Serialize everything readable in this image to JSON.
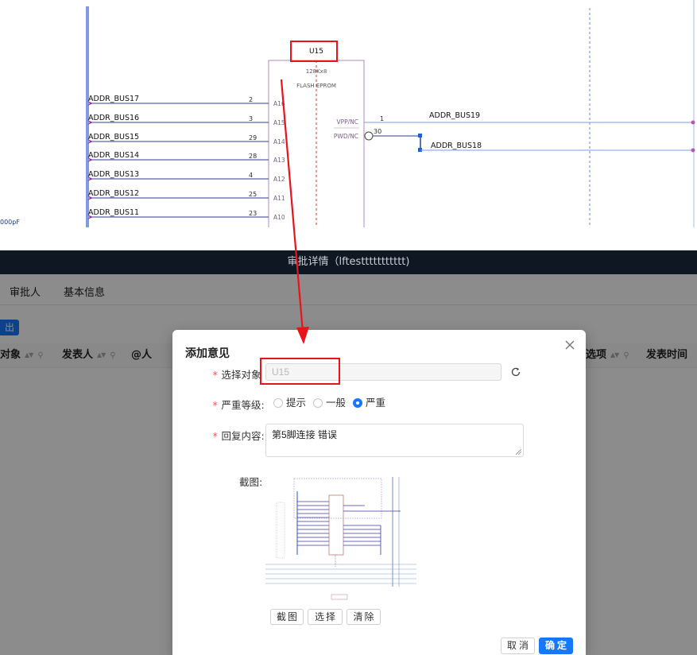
{
  "schematic": {
    "component": {
      "designator": "U15",
      "part": "128Kx8",
      "type": "FLASH EPROM"
    },
    "left_nets": [
      {
        "net": "ADDR_BUS17",
        "pin_num": "2",
        "pin_name": "A16"
      },
      {
        "net": "ADDR_BUS16",
        "pin_num": "3",
        "pin_name": "A15"
      },
      {
        "net": "ADDR_BUS15",
        "pin_num": "29",
        "pin_name": "A14"
      },
      {
        "net": "ADDR_BUS14",
        "pin_num": "28",
        "pin_name": "A13"
      },
      {
        "net": "ADDR_BUS13",
        "pin_num": "4",
        "pin_name": "A12"
      },
      {
        "net": "ADDR_BUS12",
        "pin_num": "25",
        "pin_name": "A11"
      },
      {
        "net": "ADDR_BUS11",
        "pin_num": "23",
        "pin_name": "A10"
      }
    ],
    "right_pins": [
      {
        "pin_name": "VPP/NC",
        "pin_num": "1",
        "net": "ADDR_BUS19"
      },
      {
        "pin_name": "PWD/NC",
        "pin_num": "30",
        "net": "ADDR_BUS18"
      }
    ],
    "edge_label": "000pF"
  },
  "app": {
    "title": "审批详情（lftesttttttttttt)",
    "tabs": [
      "审批人",
      "基本信息"
    ],
    "export_label": "出",
    "columns": [
      {
        "label": "对象"
      },
      {
        "label": "发表人"
      },
      {
        "label": "@人"
      },
      {
        "label": "选项"
      },
      {
        "label": "发表时间"
      }
    ]
  },
  "modal": {
    "title": "添加意见",
    "close_icon": "close-icon",
    "target": {
      "label": "选择对象",
      "value": "U15"
    },
    "severity": {
      "label": "严重等级:",
      "options": [
        "提示",
        "一般",
        "严重"
      ],
      "selected": "严重"
    },
    "reply": {
      "label": "回复内容:",
      "value": "第5脚连接 错误"
    },
    "screenshot_label": "截图:",
    "buttons": {
      "capture": "截图",
      "choose": "选择",
      "clear": "清除",
      "cancel": "取消",
      "ok": "确定"
    }
  },
  "colors": {
    "accent": "#1677ff",
    "highlight": "#e8141a",
    "wire": "#2e3f8c",
    "component": "#a05aa8"
  }
}
